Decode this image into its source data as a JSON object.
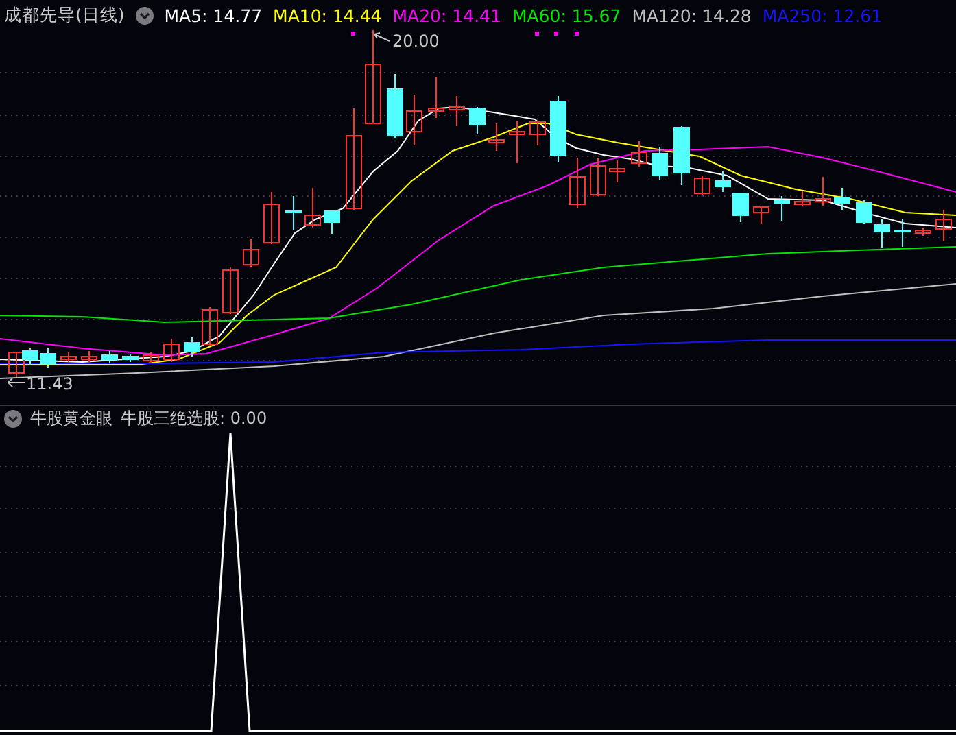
{
  "chart_header": {
    "title": "成都先导(日线)",
    "indicators": [
      {
        "label": "MA5: 14.77",
        "color": "#ffffff"
      },
      {
        "label": "MA10: 14.44",
        "color": "#ffff00"
      },
      {
        "label": "MA20: 14.41",
        "color": "#ff00ff"
      },
      {
        "label": "MA60: 15.67",
        "color": "#00e600"
      },
      {
        "label": "MA120: 14.28",
        "color": "#c0c0c0"
      },
      {
        "label": "MA250: 12.61",
        "color": "#1414ff"
      }
    ]
  },
  "price_chart": {
    "high_marker": "20.00",
    "low_marker": "11.43"
  },
  "indicator_panel": {
    "name": "牛股黄金眼",
    "reading": "牛股三绝选股: 0.00"
  }
}
